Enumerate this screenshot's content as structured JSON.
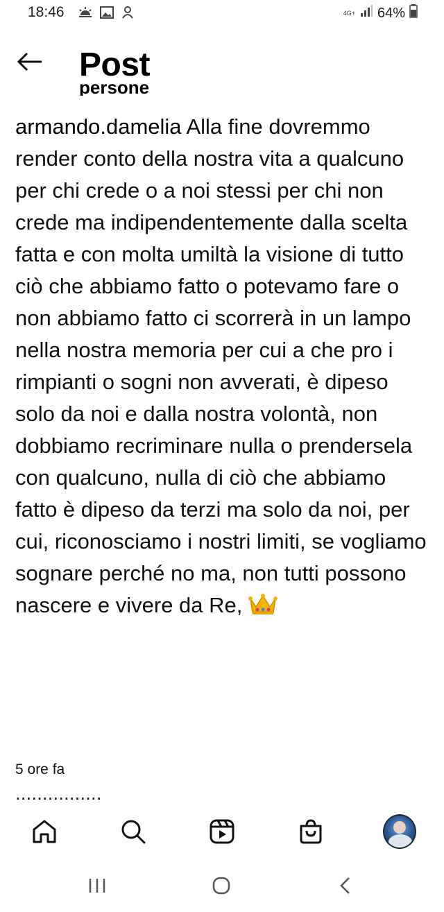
{
  "status_bar": {
    "time": "18:46",
    "network": "4G+",
    "battery": "64%",
    "icons": [
      "weather-icon",
      "gallery-icon",
      "notification-icon",
      "signal-icon",
      "battery-icon"
    ]
  },
  "header": {
    "title": "Post",
    "clipped_text": "persone"
  },
  "post": {
    "username": "armando.damelia",
    "caption": "Alla fine dovremmo render conto della nostra vita a qualcuno per chi crede o a noi stessi per chi non crede ma indipendentemente dalla scelta fatta e con molta umiltà la visione di tutto ciò che abbiamo fatto o potevamo fare o non abbiamo fatto ci scorrerà in un lampo nella nostra memoria per cui a che pro i rimpianti o  sogni non avverati, è dipeso solo da noi e dalla nostra volontà, non dobbiamo recriminare nulla o prendersela con qualcuno, nulla di ciò che abbiamo fatto è dipeso da terzi ma solo da noi, per cui, riconosciamo i nostri limiti, se vogliamo sognare perché no ma, non tutti possono nascere e vivere da Re,",
    "emoji": "crown-icon",
    "timestamp": "5 ore fa",
    "next_comment_peek": "................"
  },
  "bottom_nav": {
    "items": [
      "home-icon",
      "search-icon",
      "reels-icon",
      "shop-icon",
      "profile-avatar"
    ]
  },
  "system_nav": {
    "items": [
      "recent-apps-icon",
      "home-circle-icon",
      "back-chevron-icon"
    ]
  },
  "colors": {
    "background": "#ffffff",
    "text": "#111111",
    "crown": "#f5b400"
  }
}
